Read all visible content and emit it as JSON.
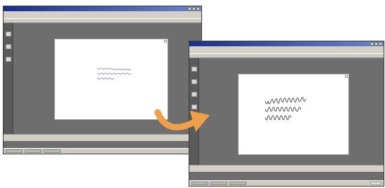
{
  "colors": {
    "window_background": "#6e6e6e",
    "title_active": "#1a2f8a",
    "arrow": "#f0a04a",
    "ink": "#2c2c2c"
  },
  "icons": {
    "transition_arrow": "curved-arrow-icon",
    "minimize": "minimize-icon",
    "maximize": "maximize-icon",
    "close": "close-icon"
  }
}
